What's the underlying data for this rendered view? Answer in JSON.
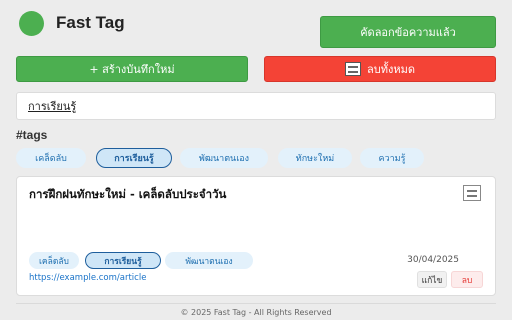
{
  "header": {
    "title": "Fast Tag",
    "copy_button": "คัดลอกข้อความแล้ว"
  },
  "toolbar": {
    "new_note_label": "+ สร้างบันทึกใหม่",
    "clear_all_label": "ลบทั้งหมด",
    "clear_all_icon": "qr-code-icon"
  },
  "search": {
    "value": "การเรียนรู้"
  },
  "tags_section": {
    "heading": "#tags",
    "tags": [
      {
        "label": "เคล็ดลับ",
        "active": false
      },
      {
        "label": "การเรียนรู้",
        "active": true
      },
      {
        "label": "พัฒนาตนเอง",
        "active": false
      },
      {
        "label": "ทักษะใหม่",
        "active": false
      },
      {
        "label": "ความรู้",
        "active": false
      }
    ]
  },
  "note_card": {
    "title": "การฝึกฝนทักษะใหม่ - เคล็ดลับประจำวัน",
    "qr_icon": "qr-code-icon",
    "tags": [
      {
        "label": "เคล็ดลับ",
        "active": false
      },
      {
        "label": "การเรียนรู้",
        "active": true
      },
      {
        "label": "พัฒนาตนเอง",
        "active": false
      }
    ],
    "date": "30/04/2025",
    "link": "https://example.com/article",
    "edit_label": "แก้ไข",
    "delete_label": "ลบ"
  },
  "footer": {
    "text": "© 2025 Fast Tag - All Rights Reserved"
  },
  "colors": {
    "accent_green": "#4caf50",
    "danger_red": "#f44336",
    "tag_bg": "#e3f1fb",
    "tag_text": "#1e6fb0",
    "link": "#1a73c8"
  }
}
